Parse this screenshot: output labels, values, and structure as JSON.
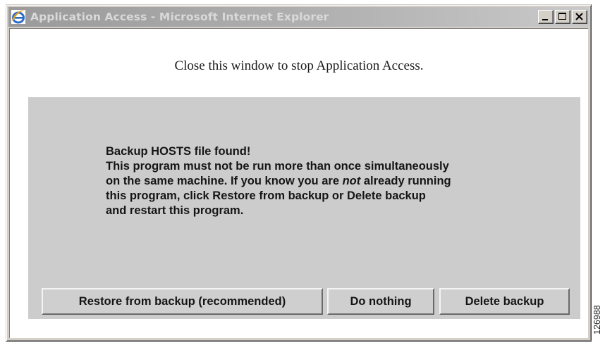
{
  "window": {
    "title": "Application Access - Microsoft Internet Explorer",
    "icon": "internet-explorer-icon",
    "controls": {
      "minimize": "minimize-icon",
      "maximize": "maximize-icon",
      "close": "close-icon"
    }
  },
  "page": {
    "stop_message": "Close this window to stop Application Access.",
    "warning": {
      "line1": "Backup HOSTS file found!",
      "line2": "This program must not be run more than once simultaneously",
      "line3_before": "on the same machine. If you know you are ",
      "line3_emphasis": "not",
      "line3_after": " already running",
      "line4": "this program, click Restore from backup or Delete backup",
      "line5": "and restart this program."
    },
    "buttons": {
      "restore": "Restore from backup (recommended)",
      "nothing": "Do nothing",
      "delete": "Delete backup"
    }
  },
  "figure_id": "126988",
  "colors": {
    "panel": "#cccccc",
    "window_chrome": "#d4d0c8",
    "title_text": "#d9d9d9"
  }
}
